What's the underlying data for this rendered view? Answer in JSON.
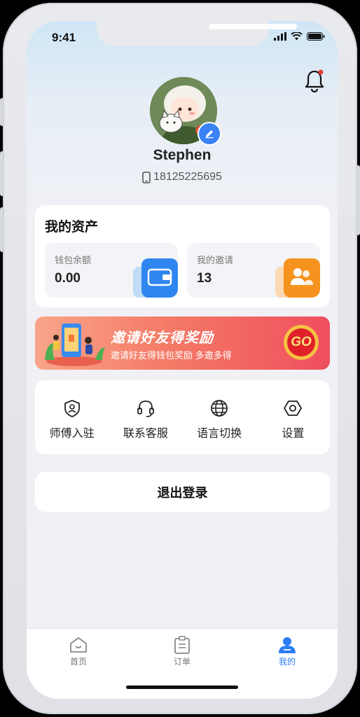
{
  "status": {
    "time": "9:41"
  },
  "profile": {
    "username": "Stephen",
    "phone": "18125225695"
  },
  "assets": {
    "title": "我的资产",
    "wallet": {
      "label": "钱包余额",
      "value": "0.00"
    },
    "invites": {
      "label": "我的邀请",
      "value": "13"
    }
  },
  "banner": {
    "title": "邀请好友得奖励",
    "subtitle": "邀请好友得钱包奖励 多邀多得",
    "go": "GO"
  },
  "menu": {
    "master": "师傅入驻",
    "support": "联系客服",
    "language": "语言切换",
    "settings": "设置"
  },
  "logout": "退出登录",
  "tabs": {
    "home": "首页",
    "orders": "订单",
    "mine": "我的"
  },
  "colors": {
    "accent": "#2a7df5",
    "notification_dot": "#e53935",
    "banner_red": "#ef4f5e"
  }
}
